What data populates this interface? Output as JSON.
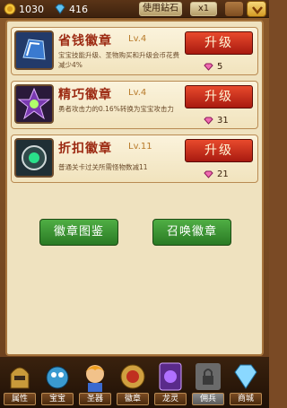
{
  "topbar": {
    "gold": "1030",
    "gems": "416",
    "use_gem_label": "使用鉆石",
    "multiplier": "x1"
  },
  "cards": [
    {
      "name": "省钱徽章",
      "level": "Lv.4",
      "desc": "宝宝技能升级、圣物购买和升级会币花费减少4%",
      "upgrade_label": "升级",
      "cost": "5"
    },
    {
      "name": "精巧徽章",
      "level": "Lv.4",
      "desc": "勇者攻击力的0.16%转换为宝宝攻击力",
      "upgrade_label": "升级",
      "cost": "31"
    },
    {
      "name": "折扣徽章",
      "level": "Lv.11",
      "desc": "普通关卡过关所需怪物数减11",
      "upgrade_label": "升级",
      "cost": "21"
    }
  ],
  "actions": {
    "emblem_book": "徽章图鉴",
    "summon_emblem": "召唤徽章"
  },
  "bottom_nav": [
    {
      "label": "属性"
    },
    {
      "label": "宝宝"
    },
    {
      "label": "圣器"
    },
    {
      "label": "徽章"
    },
    {
      "label": "龙灵"
    },
    {
      "label": "佣兵"
    },
    {
      "label": "商城"
    }
  ],
  "colors": {
    "accent_red": "#c02a14",
    "green": "#3a9434",
    "parchment": "#efe2bf"
  }
}
